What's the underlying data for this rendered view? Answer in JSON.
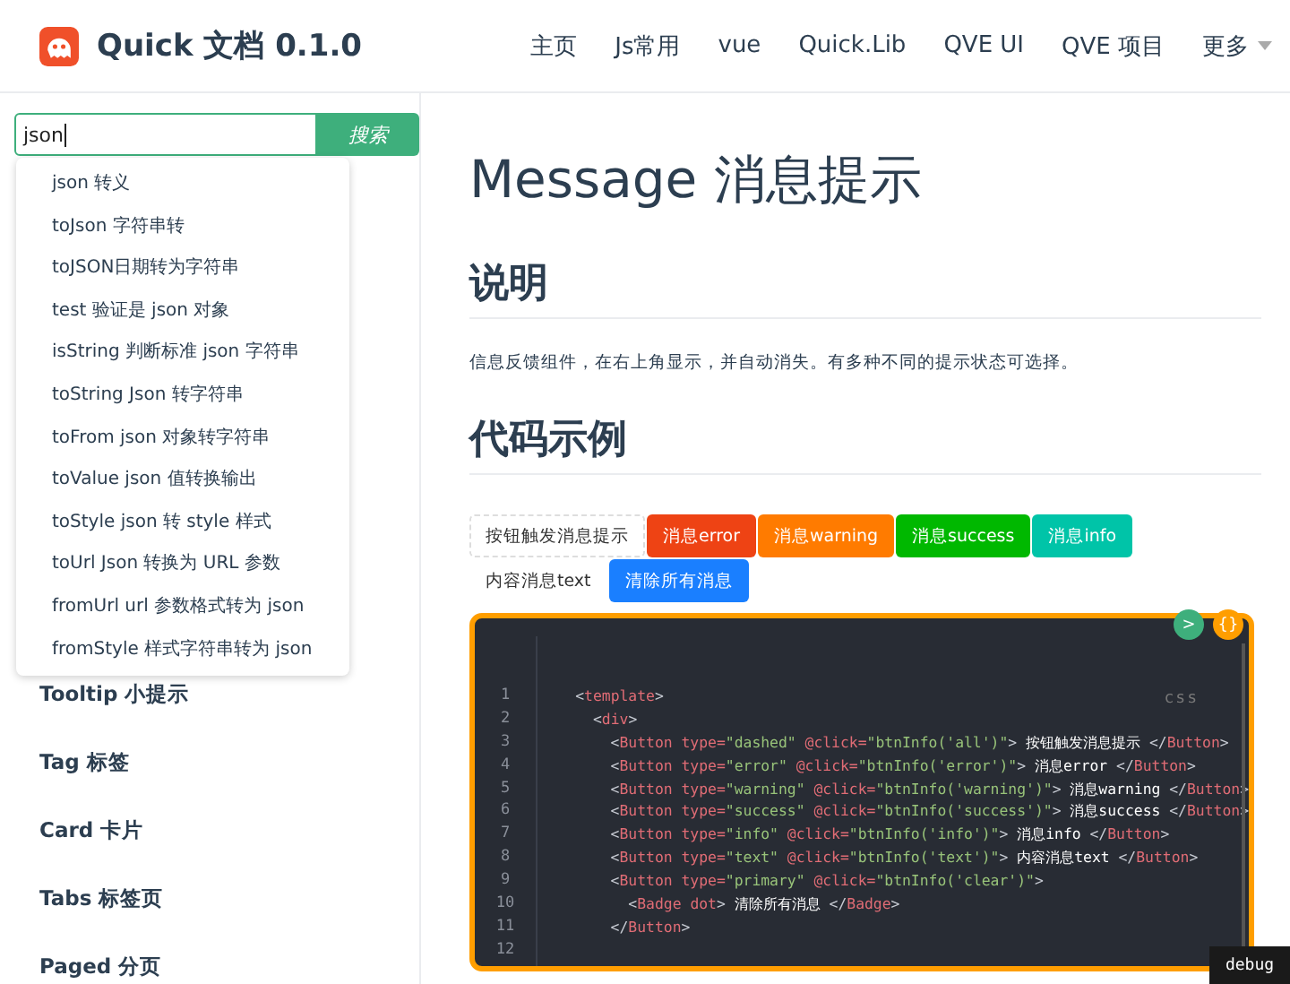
{
  "header": {
    "title": "Quick 文档 0.1.0",
    "nav": [
      {
        "label": "主页",
        "dropdown": false
      },
      {
        "label": "Js常用",
        "dropdown": false
      },
      {
        "label": "vue",
        "dropdown": false
      },
      {
        "label": "Quick.Lib",
        "dropdown": false
      },
      {
        "label": "QVE UI",
        "dropdown": false
      },
      {
        "label": "QVE 项目",
        "dropdown": false
      },
      {
        "label": "更多",
        "dropdown": true
      }
    ]
  },
  "search": {
    "value": "json",
    "button": "搜索",
    "suggestions": [
      "json 转义",
      "toJson 字符串转",
      "toJSON日期转为字符串",
      "test 验证是 json 对象",
      "isString 判断标准 json 字符串",
      "toString Json 转字符串",
      "toFrom json 对象转字符串",
      "toValue json 值转换输出",
      "toStyle json 转 style 样式",
      "toUrl Json 转换为 URL 参数",
      "fromUrl url 参数格式转为 json",
      "fromStyle 样式字符串转为 json"
    ]
  },
  "sidebar": {
    "items": [
      "Tooltip 小提示",
      "Tag 标签",
      "Card 卡片",
      "Tabs 标签页",
      "Paged 分页"
    ]
  },
  "content": {
    "title": "Message 消息提示",
    "section_1": "说明",
    "description": "信息反馈组件，在右上角显示，并自动消失。有多种不同的提示状态可选择。",
    "section_2": "代码示例",
    "demo_buttons": [
      {
        "kind": "dashed",
        "label": "按钮触发消息提示"
      },
      {
        "kind": "error",
        "label": "消息error"
      },
      {
        "kind": "warning",
        "label": "消息warning"
      },
      {
        "kind": "success",
        "label": "消息success"
      },
      {
        "kind": "info",
        "label": "消息info"
      },
      {
        "kind": "text",
        "label": "内容消息text"
      },
      {
        "kind": "primary",
        "label": "清除所有消息"
      }
    ],
    "code": {
      "run_button": ">",
      "format_button": "{}",
      "language": "css",
      "lines": [
        {
          "number": "1",
          "segments": [
            {
              "kind": "p",
              "text": "<"
            },
            {
              "kind": "tag",
              "text": "template"
            },
            {
              "kind": "p",
              "text": ">"
            }
          ]
        },
        {
          "number": "2",
          "segments": [
            {
              "kind": "p",
              "text": "  <"
            },
            {
              "kind": "tag",
              "text": "div"
            },
            {
              "kind": "p",
              "text": ">"
            }
          ]
        },
        {
          "number": "3",
          "segments": [
            {
              "kind": "p",
              "text": "    <"
            },
            {
              "kind": "tag",
              "text": "Button"
            },
            {
              "kind": "attr",
              "text": " type="
            },
            {
              "kind": "str",
              "text": "\"dashed\""
            },
            {
              "kind": "attr",
              "text": " @click="
            },
            {
              "kind": "str",
              "text": "\"btnInfo('all')\""
            },
            {
              "kind": "p",
              "text": ">"
            },
            {
              "kind": "txt",
              "text": " 按钮触发消息提示 "
            },
            {
              "kind": "p",
              "text": "</"
            },
            {
              "kind": "tag",
              "text": "Button"
            },
            {
              "kind": "p",
              "text": ">"
            }
          ]
        },
        {
          "number": "4",
          "segments": [
            {
              "kind": "p",
              "text": "    <"
            },
            {
              "kind": "tag",
              "text": "Button"
            },
            {
              "kind": "attr",
              "text": " type="
            },
            {
              "kind": "str",
              "text": "\"error\""
            },
            {
              "kind": "attr",
              "text": " @click="
            },
            {
              "kind": "str",
              "text": "\"btnInfo('error')\""
            },
            {
              "kind": "p",
              "text": ">"
            },
            {
              "kind": "txt",
              "text": " 消息error "
            },
            {
              "kind": "p",
              "text": "</"
            },
            {
              "kind": "tag",
              "text": "Button"
            },
            {
              "kind": "p",
              "text": ">"
            }
          ]
        },
        {
          "number": "5",
          "segments": [
            {
              "kind": "p",
              "text": "    <"
            },
            {
              "kind": "tag",
              "text": "Button"
            },
            {
              "kind": "attr",
              "text": " type="
            },
            {
              "kind": "str",
              "text": "\"warning\""
            },
            {
              "kind": "attr",
              "text": " @click="
            },
            {
              "kind": "str",
              "text": "\"btnInfo('warning')\""
            },
            {
              "kind": "p",
              "text": ">"
            },
            {
              "kind": "txt",
              "text": " 消息warning "
            },
            {
              "kind": "p",
              "text": "</"
            },
            {
              "kind": "tag",
              "text": "Button"
            },
            {
              "kind": "p",
              "text": ">"
            }
          ]
        },
        {
          "number": "6",
          "segments": [
            {
              "kind": "p",
              "text": "    <"
            },
            {
              "kind": "tag",
              "text": "Button"
            },
            {
              "kind": "attr",
              "text": " type="
            },
            {
              "kind": "str",
              "text": "\"success\""
            },
            {
              "kind": "attr",
              "text": " @click="
            },
            {
              "kind": "str",
              "text": "\"btnInfo('success')\""
            },
            {
              "kind": "p",
              "text": ">"
            },
            {
              "kind": "txt",
              "text": " 消息success "
            },
            {
              "kind": "p",
              "text": "</"
            },
            {
              "kind": "tag",
              "text": "Button"
            },
            {
              "kind": "p",
              "text": ">"
            }
          ]
        },
        {
          "number": "7",
          "segments": [
            {
              "kind": "p",
              "text": "    <"
            },
            {
              "kind": "tag",
              "text": "Button"
            },
            {
              "kind": "attr",
              "text": " type="
            },
            {
              "kind": "str",
              "text": "\"info\""
            },
            {
              "kind": "attr",
              "text": " @click="
            },
            {
              "kind": "str",
              "text": "\"btnInfo('info')\""
            },
            {
              "kind": "p",
              "text": ">"
            },
            {
              "kind": "txt",
              "text": " 消息info "
            },
            {
              "kind": "p",
              "text": "</"
            },
            {
              "kind": "tag",
              "text": "Button"
            },
            {
              "kind": "p",
              "text": ">"
            }
          ]
        },
        {
          "number": "8",
          "segments": [
            {
              "kind": "p",
              "text": "    <"
            },
            {
              "kind": "tag",
              "text": "Button"
            },
            {
              "kind": "attr",
              "text": " type="
            },
            {
              "kind": "str",
              "text": "\"text\""
            },
            {
              "kind": "attr",
              "text": " @click="
            },
            {
              "kind": "str",
              "text": "\"btnInfo('text')\""
            },
            {
              "kind": "p",
              "text": ">"
            },
            {
              "kind": "txt",
              "text": " 内容消息text "
            },
            {
              "kind": "p",
              "text": "</"
            },
            {
              "kind": "tag",
              "text": "Button"
            },
            {
              "kind": "p",
              "text": ">"
            }
          ]
        },
        {
          "number": "9",
          "segments": [
            {
              "kind": "p",
              "text": "    <"
            },
            {
              "kind": "tag",
              "text": "Button"
            },
            {
              "kind": "attr",
              "text": " type="
            },
            {
              "kind": "str",
              "text": "\"primary\""
            },
            {
              "kind": "attr",
              "text": " @click="
            },
            {
              "kind": "str",
              "text": "\"btnInfo('clear')\""
            },
            {
              "kind": "p",
              "text": ">"
            }
          ]
        },
        {
          "number": "10",
          "segments": [
            {
              "kind": "p",
              "text": "      <"
            },
            {
              "kind": "tag",
              "text": "Badge"
            },
            {
              "kind": "attr",
              "text": " dot"
            },
            {
              "kind": "p",
              "text": ">"
            },
            {
              "kind": "txt",
              "text": " 清除所有消息 "
            },
            {
              "kind": "p",
              "text": "</"
            },
            {
              "kind": "tag",
              "text": "Badge"
            },
            {
              "kind": "p",
              "text": ">"
            }
          ]
        },
        {
          "number": "11",
          "segments": [
            {
              "kind": "p",
              "text": "    </"
            },
            {
              "kind": "tag",
              "text": "Button"
            },
            {
              "kind": "p",
              "text": ">"
            }
          ]
        },
        {
          "number": "12"
        }
      ]
    }
  },
  "debug_badge": "debug"
}
